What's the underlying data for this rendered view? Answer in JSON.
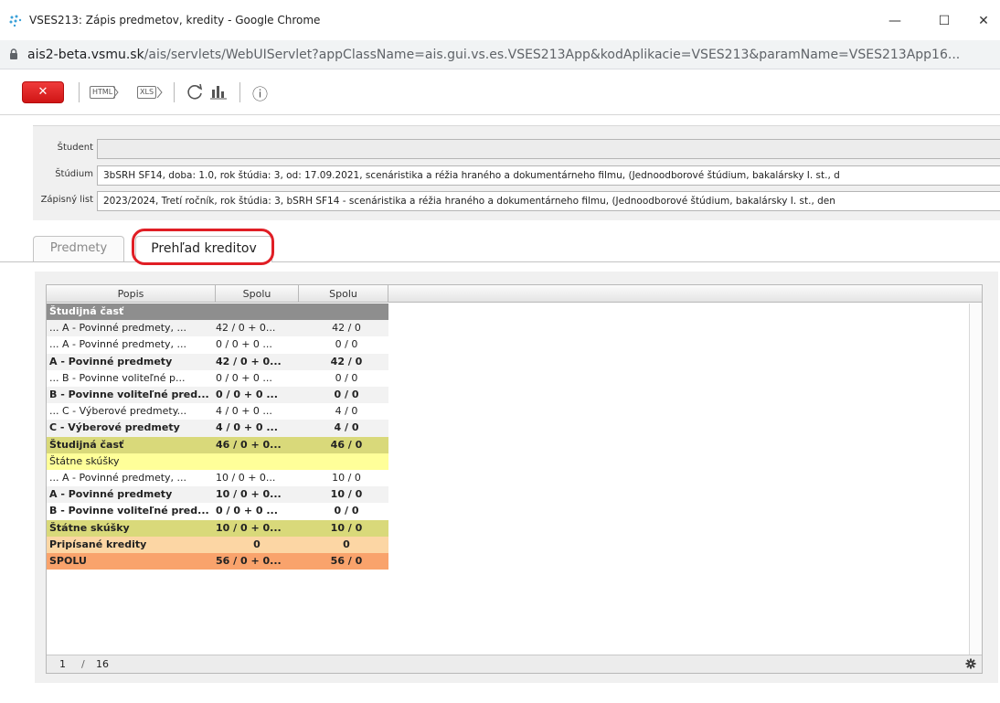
{
  "window": {
    "title": "VSES213: Zápis predmetov, kredity - Google Chrome",
    "minimize": "—",
    "maximize": "☐",
    "close": "✕"
  },
  "address": {
    "host": "ais2-beta.vsmu.sk",
    "path": "/ais/servlets/WebUIServlet?appClassName=ais.gui.vs.es.VSES213App&kodAplikacie=VSES213&paramName=VSES213App16..."
  },
  "toolbar": {
    "close_label": "✕",
    "html_label": "HTML",
    "xls_label": "XLS",
    "info_label": "ⓘ"
  },
  "student_info": {
    "student_label": "Študent",
    "student_value": "",
    "study_label": "Štúdium",
    "study_value": "3bSRH SF14, doba: 1.0, rok štúdia: 3, od: 17.09.2021, scenáristika a réžia hraného a dokumentárneho filmu, (Jednoodborové štúdium, bakalársky I. st., d",
    "enrollment_label": "Zápisný list",
    "enrollment_value": "2023/2024, Tretí ročník, rok štúdia: 3, bSRH SF14 - scenáristika a réžia hraného a dokumentárneho filmu, (Jednoodborové štúdium, bakalársky I. st., den"
  },
  "tabs": [
    {
      "label": "Predmety",
      "active": false
    },
    {
      "label": "Prehľad kreditov",
      "active": true
    }
  ],
  "grid": {
    "columns": [
      "Popis",
      "Spolu",
      "Spolu"
    ],
    "rows": [
      {
        "popis": "Študijná časť",
        "spolu1": "",
        "spolu2": "",
        "style": "r-header"
      },
      {
        "popis": "... A - Povinné predmety, ...",
        "spolu1": "42 / 0 + 0...",
        "spolu2": "42 / 0",
        "style": "r-plain"
      },
      {
        "popis": "... A - Povinné predmety, ...",
        "spolu1": "0 / 0 + 0 ...",
        "spolu2": "0 / 0",
        "style": "r-alt"
      },
      {
        "popis": "A - Povinné predmety",
        "spolu1": "42 / 0 + 0...",
        "spolu2": "42 / 0",
        "style": "r-plain bold"
      },
      {
        "popis": "... B - Povinne voliteľné p...",
        "spolu1": "0 / 0 + 0 ...",
        "spolu2": "0 / 0",
        "style": "r-alt"
      },
      {
        "popis": "B - Povinne voliteľné pred...",
        "spolu1": "0 / 0 + 0 ...",
        "spolu2": "0 / 0",
        "style": "r-plain bold"
      },
      {
        "popis": "... C - Výberové predmety...",
        "spolu1": "4 / 0 + 0 ...",
        "spolu2": "4 / 0",
        "style": "r-alt"
      },
      {
        "popis": "C - Výberové predmety",
        "spolu1": "4 / 0 + 0 ...",
        "spolu2": "4 / 0",
        "style": "r-plain bold"
      },
      {
        "popis": "Študijná časť",
        "spolu1": "46 / 0 + 0...",
        "spolu2": "46 / 0",
        "style": "r-olive"
      },
      {
        "popis": "Štátne skúšky",
        "spolu1": "",
        "spolu2": "",
        "style": "r-yellow"
      },
      {
        "popis": "... A - Povinné predmety, ...",
        "spolu1": "10 / 0 + 0...",
        "spolu2": "10 / 0",
        "style": "r-alt"
      },
      {
        "popis": "A - Povinné predmety",
        "spolu1": "10 / 0 + 0...",
        "spolu2": "10 / 0",
        "style": "r-plain bold"
      },
      {
        "popis": "B - Povinne voliteľné pred...",
        "spolu1": "0 / 0 + 0 ...",
        "spolu2": "0 / 0",
        "style": "r-alt bold"
      },
      {
        "popis": "Štátne skúšky",
        "spolu1": "10 / 0 + 0...",
        "spolu2": "10 / 0",
        "style": "r-olive"
      },
      {
        "popis": "Pripísané kredity",
        "spolu1": "0",
        "spolu2": "0",
        "style": "r-peach",
        "center": true
      },
      {
        "popis": "SPOLU",
        "spolu1": "56 / 0 + 0...",
        "spolu2": "56 / 0",
        "style": "r-orange"
      }
    ],
    "footer": {
      "page": "1",
      "separator": "/",
      "total": "16"
    }
  }
}
